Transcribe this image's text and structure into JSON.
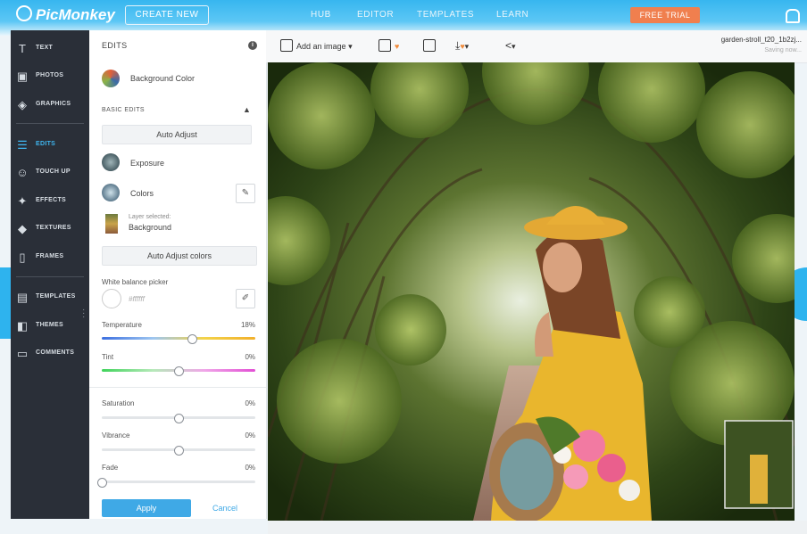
{
  "topbar": {
    "logo": "PicMonkey",
    "create_new": "CREATE NEW",
    "nav": [
      "HUB",
      "EDITOR",
      "TEMPLATES",
      "LEARN"
    ],
    "free_trial": "FREE TRIAL"
  },
  "leftnav": {
    "items": [
      {
        "label": "TEXT",
        "icon": "text-icon"
      },
      {
        "label": "PHOTOS",
        "icon": "photos-icon"
      },
      {
        "label": "GRAPHICS",
        "icon": "graphics-icon"
      },
      {
        "label": "EDITS",
        "icon": "edits-icon",
        "active": true
      },
      {
        "label": "TOUCH UP",
        "icon": "touch-up-icon"
      },
      {
        "label": "EFFECTS",
        "icon": "effects-icon"
      },
      {
        "label": "TEXTURES",
        "icon": "textures-icon"
      },
      {
        "label": "FRAMES",
        "icon": "frames-icon"
      },
      {
        "label": "TEMPLATES",
        "icon": "templates-icon"
      },
      {
        "label": "THEMES",
        "icon": "themes-icon"
      },
      {
        "label": "COMMENTS",
        "icon": "comments-icon"
      }
    ]
  },
  "panel": {
    "title": "EDITS",
    "background_color": "Background Color",
    "basic_edits": "BASIC EDITS",
    "auto_adjust": "Auto Adjust",
    "exposure": "Exposure",
    "colors": "Colors",
    "layer_selected": "Layer selected:",
    "layer_name": "Background",
    "auto_adjust_colors": "Auto Adjust colors",
    "white_balance_picker": "White balance picker",
    "white_balance_value": "#ffffff",
    "sliders": [
      {
        "label": "Temperature",
        "value_text": "18%",
        "value": 0.59
      },
      {
        "label": "Tint",
        "value_text": "0%",
        "value": 0.5
      },
      {
        "label": "Saturation",
        "value_text": "0%",
        "value": 0.5
      },
      {
        "label": "Vibrance",
        "value_text": "0%",
        "value": 0.5
      },
      {
        "label": "Fade",
        "value_text": "0%",
        "value": 0.0
      }
    ],
    "apply": "Apply",
    "cancel": "Cancel"
  },
  "toolbar": {
    "add_image": "Add an image",
    "filename": "garden-stroll_t20_1b2zj...",
    "status": "Saving now..."
  },
  "colors": {
    "accent": "#3fa9e6",
    "nav_bg": "#2a2f38",
    "trial": "#f07f4e"
  }
}
